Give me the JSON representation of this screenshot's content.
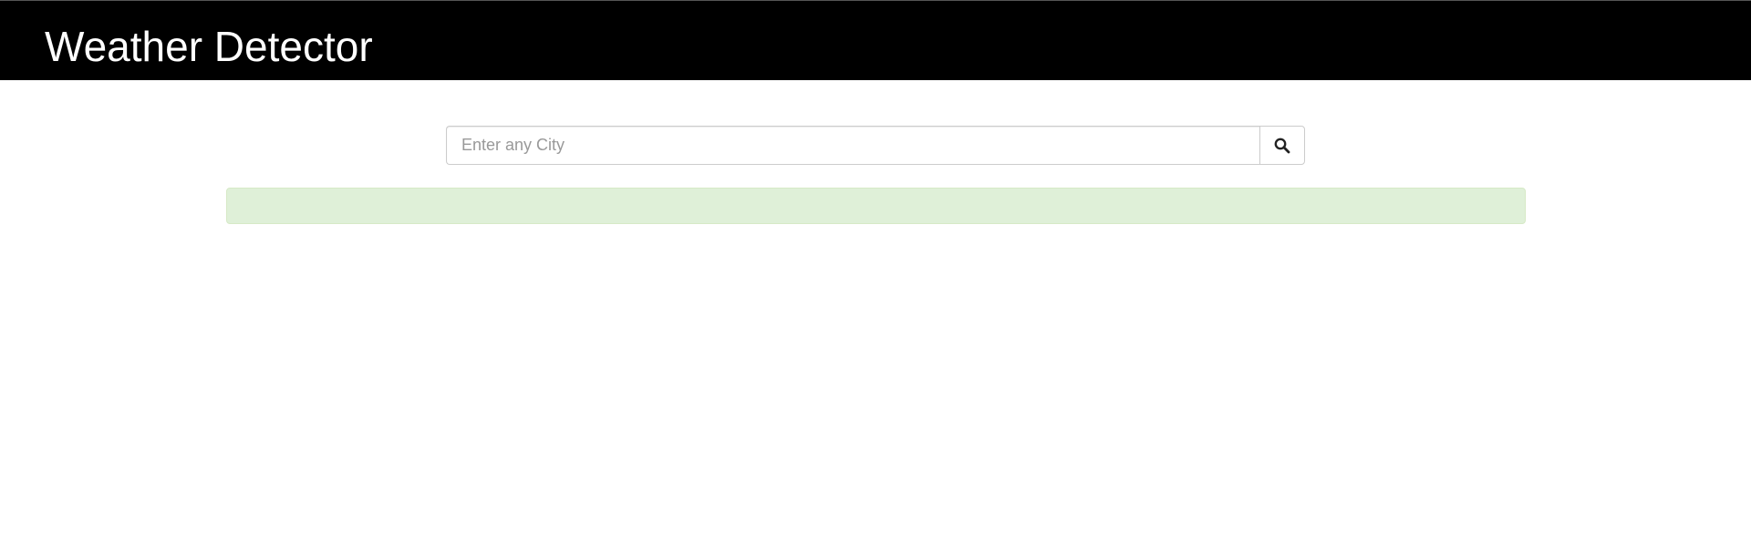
{
  "header": {
    "title": "Weather Detector",
    "background_color": "#000000",
    "title_color": "#ffffff"
  },
  "search": {
    "value": "",
    "placeholder": "Enter any City",
    "button_icon": "search-icon"
  },
  "result": {
    "message": "",
    "background_color": "#dff0d8"
  }
}
